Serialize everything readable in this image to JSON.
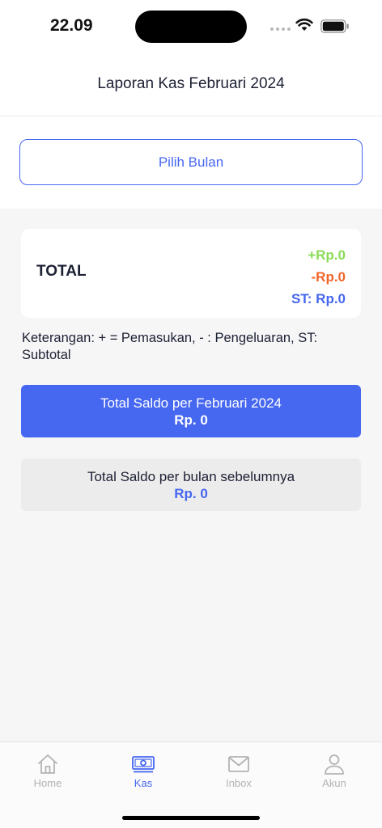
{
  "status_bar": {
    "time": "22.09"
  },
  "header": {
    "title": "Laporan Kas Februari 2024"
  },
  "picker": {
    "button_label": "Pilih Bulan"
  },
  "total_card": {
    "label": "TOTAL",
    "income": "+Rp.0",
    "expense": "-Rp.0",
    "subtotal": "ST: Rp.0"
  },
  "legend": "Keterangan: + = Pemasukan, - : Pengeluaran, ST: Subtotal",
  "saldo_current": {
    "label": "Total Saldo per Februari 2024",
    "value": "Rp. 0"
  },
  "saldo_previous": {
    "label": "Total Saldo per bulan sebelumnya",
    "value": "Rp. 0"
  },
  "tabs": [
    {
      "label": "Home",
      "icon": "home-icon",
      "active": false
    },
    {
      "label": "Kas",
      "icon": "money-icon",
      "active": true
    },
    {
      "label": "Inbox",
      "icon": "mail-icon",
      "active": false
    },
    {
      "label": "Akun",
      "icon": "user-icon",
      "active": false
    }
  ],
  "colors": {
    "accent": "#4667f0",
    "income": "#8bdc58",
    "expense": "#f0662a",
    "inactive": "#b3b3b3"
  }
}
